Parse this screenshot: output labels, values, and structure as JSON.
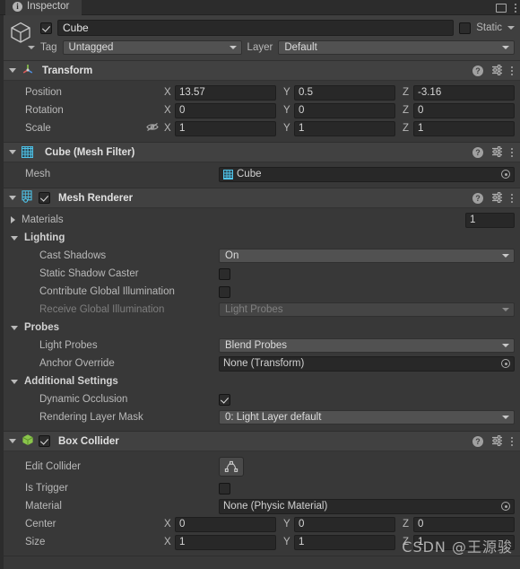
{
  "window": {
    "tab_label": "Inspector",
    "tab_icon": "info-icon",
    "maximize_icon": "window-icon",
    "menu_icon": "kebab-menu-icon"
  },
  "gameobject": {
    "icon": "cube-outline-icon",
    "enabled": true,
    "name": "Cube",
    "static_label": "Static",
    "static_checked": false,
    "tag_label": "Tag",
    "tag_value": "Untagged",
    "layer_label": "Layer",
    "layer_value": "Default"
  },
  "components": [
    {
      "name": "Transform",
      "icon": "transform-axis-icon",
      "expanded": true,
      "has_enable_toggle": false,
      "rows": [
        {
          "label": "Position",
          "type": "vector3",
          "x": "13.57",
          "y": "0.5",
          "z": "-3.16"
        },
        {
          "label": "Rotation",
          "type": "vector3",
          "x": "0",
          "y": "0",
          "z": "0"
        },
        {
          "label": "Scale",
          "type": "vector3",
          "x": "1",
          "y": "1",
          "z": "1",
          "prefix_icon": "constrain-proportions-off-icon"
        }
      ]
    },
    {
      "name": "Cube (Mesh Filter)",
      "icon": "mesh-filter-icon",
      "expanded": true,
      "has_enable_toggle": false,
      "rows": [
        {
          "label": "Mesh",
          "type": "object",
          "value": "Cube",
          "value_icon": "mesh-icon"
        }
      ]
    },
    {
      "name": "Mesh Renderer",
      "icon": "mesh-renderer-icon",
      "expanded": true,
      "has_enable_toggle": true,
      "enabled": true,
      "rows": [
        {
          "label": "Materials",
          "type": "foldout-count",
          "expanded": false,
          "count": "1"
        },
        {
          "label": "Lighting",
          "type": "group",
          "expanded": true
        },
        {
          "label": "Cast Shadows",
          "type": "dropdown",
          "value": "On",
          "indent": 2
        },
        {
          "label": "Static Shadow Caster",
          "type": "checkbox",
          "checked": false,
          "indent": 2
        },
        {
          "label": "Contribute Global Illumination",
          "type": "checkbox",
          "checked": false,
          "indent": 2
        },
        {
          "label": "Receive Global Illumination",
          "type": "dropdown",
          "value": "Light Probes",
          "indent": 2,
          "disabled": true
        },
        {
          "label": "Probes",
          "type": "group",
          "expanded": true
        },
        {
          "label": "Light Probes",
          "type": "dropdown",
          "value": "Blend Probes",
          "indent": 2
        },
        {
          "label": "Anchor Override",
          "type": "object",
          "value": "None (Transform)",
          "indent": 2
        },
        {
          "label": "Additional Settings",
          "type": "group",
          "expanded": true
        },
        {
          "label": "Dynamic Occlusion",
          "type": "checkbox",
          "checked": true,
          "indent": 2
        },
        {
          "label": "Rendering Layer Mask",
          "type": "dropdown",
          "value": "0: Light Layer default",
          "indent": 2
        }
      ]
    },
    {
      "name": "Box Collider",
      "icon": "box-collider-icon",
      "expanded": true,
      "has_enable_toggle": true,
      "enabled": true,
      "rows": [
        {
          "label": "Edit Collider",
          "type": "button",
          "button_icon": "edit-collider-icon"
        },
        {
          "label": "Is Trigger",
          "type": "checkbox",
          "checked": false
        },
        {
          "label": "Material",
          "type": "object",
          "value": "None (Physic Material)"
        },
        {
          "label": "Center",
          "type": "vector3",
          "x": "0",
          "y": "0",
          "z": "0"
        },
        {
          "label": "Size",
          "type": "vector3",
          "x": "1",
          "y": "1",
          "z": "1"
        }
      ]
    }
  ],
  "component_tools": {
    "help_icon": "help-icon",
    "preset_icon": "preset-settings-icon",
    "menu_icon": "kebab-menu-icon"
  },
  "axes": {
    "x": "X",
    "y": "Y",
    "z": "Z"
  },
  "watermark": {
    "text": "CSDN @王源骏"
  },
  "colors": {
    "background": "#383838",
    "header": "#414141",
    "field": "#282828",
    "dropdown": "#515151",
    "accent_cyan": "#4fc3e8",
    "accent_green": "#8ac54b"
  }
}
